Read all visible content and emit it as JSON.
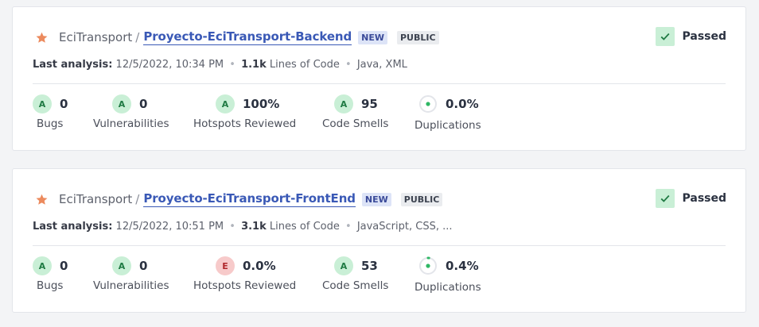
{
  "icons": {
    "favorite": "star-icon",
    "quality_gate": "check-icon",
    "duplications": "donut-icon"
  },
  "colors": {
    "star": "#ec8a5d",
    "link": "#3a59b6",
    "rating_A": "#c9efd6",
    "rating_E": "#f7caca",
    "check": "#1f7a43",
    "dup_fill": "#2fb765"
  },
  "cards": [
    {
      "org": "EciTransport",
      "separator": "/",
      "project": "Proyecto-EciTransport-Backend",
      "badges": {
        "new": "NEW",
        "public": "PUBLIC"
      },
      "quality_gate": "Passed",
      "analysis": {
        "label": "Last analysis:",
        "date": "12/5/2022, 10:34 PM",
        "dot": "•",
        "loc_value": "1.1k",
        "loc_label": "Lines of Code",
        "dot2": "•",
        "languages": "Java, XML"
      },
      "metrics": {
        "bugs": {
          "rating": "A",
          "value": "0",
          "label": "Bugs"
        },
        "vulnerabilities": {
          "rating": "A",
          "value": "0",
          "label": "Vulnerabilities"
        },
        "hotspots": {
          "rating": "A",
          "value": "100%",
          "label": "Hotspots Reviewed"
        },
        "code_smells": {
          "rating": "A",
          "value": "95",
          "label": "Code Smells"
        },
        "duplications": {
          "value": "0.0%",
          "label": "Duplications",
          "fraction": 0.0
        }
      }
    },
    {
      "org": "EciTransport",
      "separator": "/",
      "project": "Proyecto-EciTransport-FrontEnd",
      "badges": {
        "new": "NEW",
        "public": "PUBLIC"
      },
      "quality_gate": "Passed",
      "analysis": {
        "label": "Last analysis:",
        "date": "12/5/2022, 10:51 PM",
        "dot": "•",
        "loc_value": "3.1k",
        "loc_label": "Lines of Code",
        "dot2": "•",
        "languages": "JavaScript, CSS, ..."
      },
      "metrics": {
        "bugs": {
          "rating": "A",
          "value": "0",
          "label": "Bugs"
        },
        "vulnerabilities": {
          "rating": "A",
          "value": "0",
          "label": "Vulnerabilities"
        },
        "hotspots": {
          "rating": "E",
          "value": "0.0%",
          "label": "Hotspots Reviewed"
        },
        "code_smells": {
          "rating": "A",
          "value": "53",
          "label": "Code Smells"
        },
        "duplications": {
          "value": "0.4%",
          "label": "Duplications",
          "fraction": 0.004
        }
      }
    }
  ]
}
